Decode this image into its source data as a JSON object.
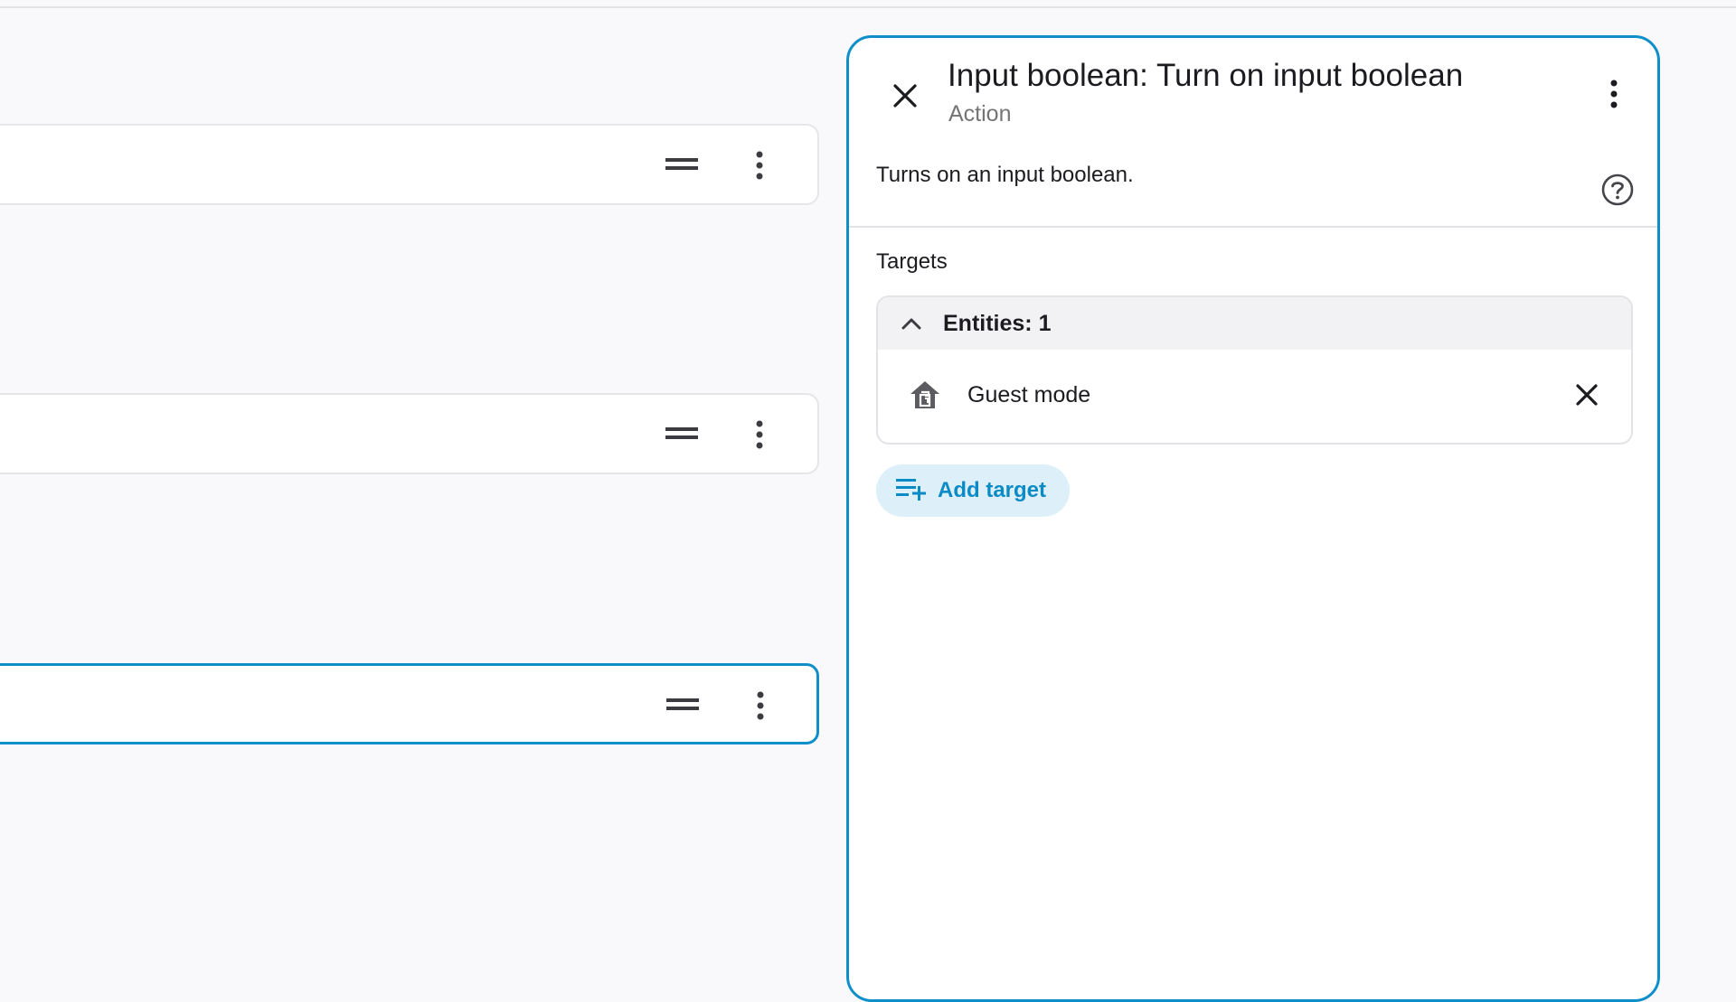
{
  "editor_rows": [
    {
      "id": "row-1",
      "selected": false
    },
    {
      "id": "row-2",
      "selected": false
    },
    {
      "id": "row-3",
      "selected": true
    }
  ],
  "panel": {
    "title": "Input boolean: Turn on input boolean",
    "subtitle": "Action",
    "description": "Turns on an input boolean.",
    "targets_label": "Targets",
    "entities_header": "Entities: 1",
    "entities": [
      {
        "name": "Guest mode",
        "icon": "home-account-icon"
      }
    ],
    "add_target_label": "Add target"
  },
  "colors": {
    "accent": "#0f8fca",
    "add_target_bg": "#ddeff8",
    "add_target_text": "#0a8bc6",
    "background": "#f9f8fb"
  }
}
